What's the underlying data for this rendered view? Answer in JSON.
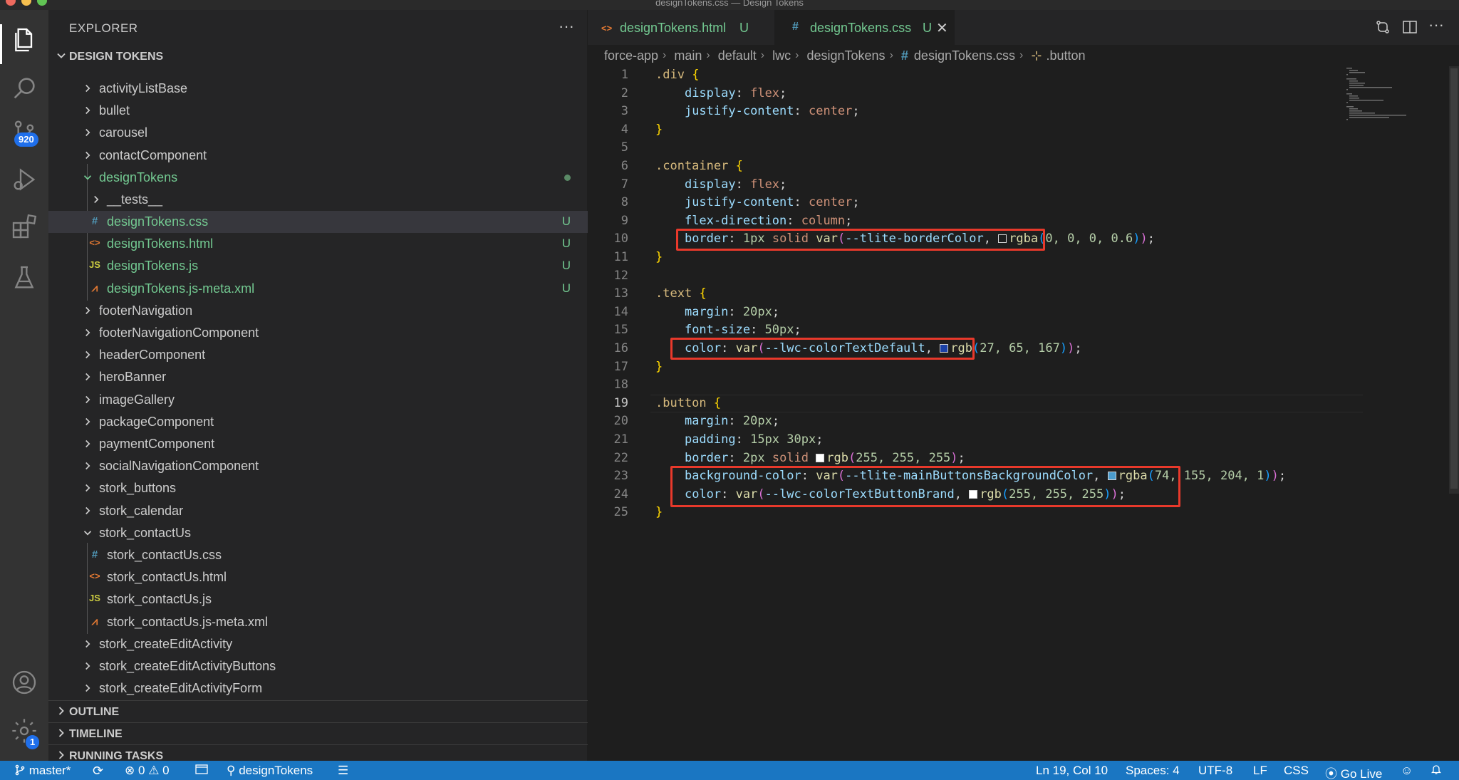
{
  "window": {
    "title": "designTokens.css — Design Tokens"
  },
  "activity_bar": {
    "items": [
      {
        "icon": "files-icon"
      },
      {
        "icon": "search-icon"
      },
      {
        "icon": "source-control-icon",
        "badge": "920"
      },
      {
        "icon": "run-debug-icon"
      },
      {
        "icon": "extensions-icon"
      },
      {
        "icon": "testing-icon"
      }
    ],
    "bottom": [
      {
        "icon": "account-icon"
      },
      {
        "icon": "manage-gear-icon",
        "badge": "1"
      }
    ]
  },
  "sidebar": {
    "title": "EXPLORER",
    "more": "···",
    "root_label": "DESIGN TOKENS",
    "tree": [
      {
        "name": "activityListBase",
        "type": "folder",
        "expanded": false
      },
      {
        "name": "bullet",
        "type": "folder",
        "expanded": false
      },
      {
        "name": "carousel",
        "type": "folder",
        "expanded": false
      },
      {
        "name": "contactComponent",
        "type": "folder",
        "expanded": false
      },
      {
        "name": "designTokens",
        "type": "folder",
        "expanded": true,
        "modified": true
      },
      {
        "name": "__tests__",
        "type": "folder",
        "expanded": false
      },
      {
        "name": "designTokens.css",
        "type": "css",
        "status": "U",
        "selected": true
      },
      {
        "name": "designTokens.html",
        "type": "html",
        "status": "U"
      },
      {
        "name": "designTokens.js",
        "type": "js",
        "status": "U"
      },
      {
        "name": "designTokens.js-meta.xml",
        "type": "xml",
        "status": "U"
      },
      {
        "name": "footerNavigation",
        "type": "folder",
        "expanded": false
      },
      {
        "name": "footerNavigationComponent",
        "type": "folder",
        "expanded": false
      },
      {
        "name": "headerComponent",
        "type": "folder",
        "expanded": false
      },
      {
        "name": "heroBanner",
        "type": "folder",
        "expanded": false
      },
      {
        "name": "imageGallery",
        "type": "folder",
        "expanded": false
      },
      {
        "name": "packageComponent",
        "type": "folder",
        "expanded": false
      },
      {
        "name": "paymentComponent",
        "type": "folder",
        "expanded": false
      },
      {
        "name": "socialNavigationComponent",
        "type": "folder",
        "expanded": false
      },
      {
        "name": "stork_buttons",
        "type": "folder",
        "expanded": false
      },
      {
        "name": "stork_calendar",
        "type": "folder",
        "expanded": false
      },
      {
        "name": "stork_contactUs",
        "type": "folder",
        "expanded": true
      },
      {
        "name": "stork_contactUs.css",
        "type": "css"
      },
      {
        "name": "stork_contactUs.html",
        "type": "html"
      },
      {
        "name": "stork_contactUs.js",
        "type": "js"
      },
      {
        "name": "stork_contactUs.js-meta.xml",
        "type": "xml"
      },
      {
        "name": "stork_createEditActivity",
        "type": "folder",
        "expanded": false
      },
      {
        "name": "stork_createEditActivityButtons",
        "type": "folder",
        "expanded": false
      },
      {
        "name": "stork_createEditActivityForm",
        "type": "folder",
        "expanded": false
      }
    ],
    "sections": [
      "OUTLINE",
      "TIMELINE",
      "RUNNING TASKS"
    ]
  },
  "tabs": [
    {
      "icon": "<>",
      "label": "designTokens.html",
      "status": "U",
      "active": false
    },
    {
      "icon": "#",
      "label": "designTokens.css",
      "status": "U",
      "active": true,
      "close": "✕"
    }
  ],
  "breadcrumb": [
    "force-app",
    "main",
    "default",
    "lwc",
    "designTokens",
    "designTokens.css",
    ".button"
  ],
  "breadcrumb_icons": {
    "css_file": "#",
    "symbol": "⊹"
  },
  "editor": {
    "current_line": 19,
    "line_numbers": [
      "1",
      "2",
      "3",
      "4",
      "5",
      "6",
      "7",
      "8",
      "9",
      "10",
      "11",
      "12",
      "13",
      "14",
      "15",
      "16",
      "17",
      "18",
      "19",
      "20",
      "21",
      "22",
      "23",
      "24",
      "25"
    ],
    "code": {
      "l1_sel": ".div",
      "l2_prop": "display",
      "l2_val": "flex",
      "l3_prop": "justify-content",
      "l3_val": "center",
      "l6_sel": ".container",
      "l7_prop": "display",
      "l7_val": "flex",
      "l8_prop": "justify-content",
      "l8_val": "center",
      "l9_prop": "flex-direction",
      "l9_val": "column",
      "l10_prop": "border",
      "l10_num": "1px",
      "l10_kw": "solid",
      "l10_fn": "var",
      "l10_var": "--tlite-borderColor",
      "l10_fn2": "rgba",
      "l10_args": "0, 0, 0, 0.6",
      "l10_swatch": "#1e1e1e",
      "l13_sel": ".text",
      "l14_prop": "margin",
      "l14_num": "20px",
      "l15_prop": "font-size",
      "l15_num": "50px",
      "l16_prop": "color",
      "l16_fn": "var",
      "l16_var": "--lwc-colorTextDefault",
      "l16_fn2": "rgb",
      "l16_args": "27, 65, 167",
      "l16_swatch": "#1b41a7",
      "l19_sel": ".button",
      "l20_prop": "margin",
      "l20_num": "20px",
      "l21_prop": "padding",
      "l21_num": "15px 30px",
      "l22_prop": "border",
      "l22_num": "2px",
      "l22_kw": "solid",
      "l22_fn": "rgb",
      "l22_args": "255, 255, 255",
      "l22_swatch": "#ffffff",
      "l23_prop": "background-color",
      "l23_fn": "var",
      "l23_var": "--tlite-mainButtonsBackgroundColor",
      "l23_fn2": "rgba",
      "l23_args": "74, 155, 204, 1",
      "l23_swatch": "#4a9bcc",
      "l24_prop": "color",
      "l24_fn": "var",
      "l24_var": "--lwc-colorTextButtonBrand",
      "l24_fn2": "rgb",
      "l24_args": "255, 255, 255",
      "l24_swatch": "#ffffff"
    }
  },
  "status_bar": {
    "branch": "master*",
    "errors": "0",
    "warnings": "0",
    "project": "designTokens",
    "position": "Ln 19, Col 10",
    "spaces": "Spaces: 4",
    "encoding": "UTF-8",
    "eol": "LF",
    "language": "CSS",
    "golive": "Go Live"
  },
  "colors": {
    "status_bar": "#1a76c2",
    "highlight_box": "#e8392b",
    "untracked": "#73c991"
  }
}
